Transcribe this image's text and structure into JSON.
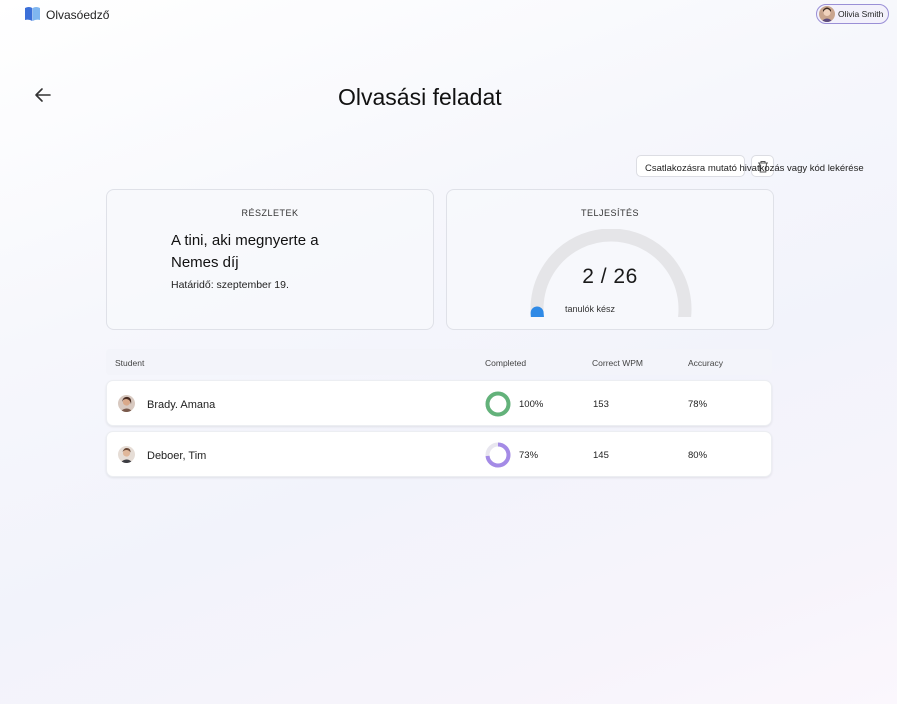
{
  "app": {
    "name": "Olvasóedző",
    "user_name": "Olivia Smith"
  },
  "page": {
    "title": "Olvasási feladat",
    "join_button_label": "Csatlakozásra mutató hivatkozás vagy kód lekérése"
  },
  "details": {
    "heading": "RÉSZLETEK",
    "book_title_line1": "A tini, aki megnyerte a",
    "book_title_line2": "Nemes díj",
    "due": "Határidő: szeptember 19."
  },
  "progress": {
    "heading": "TELJESÍTÉS",
    "count": "2 / 26",
    "completed": 2,
    "total": 26,
    "sub_label": "tanulók kész"
  },
  "table": {
    "headers": {
      "student": "Student",
      "completed": "Completed",
      "wpm": "Correct WPM",
      "accuracy": "Accuracy"
    },
    "rows": [
      {
        "name": "Brady. Amana",
        "completed": "100%",
        "completed_fraction": 1.0,
        "wpm": "153",
        "accuracy": "78%",
        "ring_color": "#63b27a"
      },
      {
        "name": "Deboer, Tim",
        "completed": "73%",
        "completed_fraction": 0.73,
        "wpm": "145",
        "accuracy": "80%",
        "ring_color": "#a48be6"
      }
    ]
  },
  "colors": {
    "gauge_fill": "#2f8ae6",
    "gauge_track": "#e5e5e8",
    "accent": "#8f84d4"
  }
}
